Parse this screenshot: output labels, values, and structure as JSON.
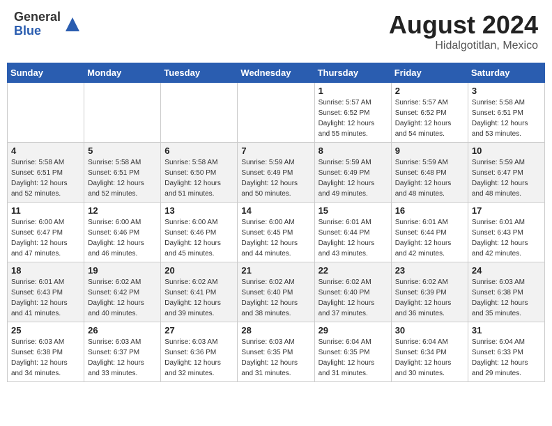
{
  "header": {
    "logo_general": "General",
    "logo_blue": "Blue",
    "title": "August 2024",
    "location": "Hidalgotitlan, Mexico"
  },
  "days_of_week": [
    "Sunday",
    "Monday",
    "Tuesday",
    "Wednesday",
    "Thursday",
    "Friday",
    "Saturday"
  ],
  "weeks": [
    {
      "row": 1,
      "days": [
        {
          "date": "",
          "info": ""
        },
        {
          "date": "",
          "info": ""
        },
        {
          "date": "",
          "info": ""
        },
        {
          "date": "",
          "info": ""
        },
        {
          "date": "1",
          "info": "Sunrise: 5:57 AM\nSunset: 6:52 PM\nDaylight: 12 hours\nand 55 minutes."
        },
        {
          "date": "2",
          "info": "Sunrise: 5:57 AM\nSunset: 6:52 PM\nDaylight: 12 hours\nand 54 minutes."
        },
        {
          "date": "3",
          "info": "Sunrise: 5:58 AM\nSunset: 6:51 PM\nDaylight: 12 hours\nand 53 minutes."
        }
      ]
    },
    {
      "row": 2,
      "days": [
        {
          "date": "4",
          "info": "Sunrise: 5:58 AM\nSunset: 6:51 PM\nDaylight: 12 hours\nand 52 minutes."
        },
        {
          "date": "5",
          "info": "Sunrise: 5:58 AM\nSunset: 6:51 PM\nDaylight: 12 hours\nand 52 minutes."
        },
        {
          "date": "6",
          "info": "Sunrise: 5:58 AM\nSunset: 6:50 PM\nDaylight: 12 hours\nand 51 minutes."
        },
        {
          "date": "7",
          "info": "Sunrise: 5:59 AM\nSunset: 6:49 PM\nDaylight: 12 hours\nand 50 minutes."
        },
        {
          "date": "8",
          "info": "Sunrise: 5:59 AM\nSunset: 6:49 PM\nDaylight: 12 hours\nand 49 minutes."
        },
        {
          "date": "9",
          "info": "Sunrise: 5:59 AM\nSunset: 6:48 PM\nDaylight: 12 hours\nand 48 minutes."
        },
        {
          "date": "10",
          "info": "Sunrise: 5:59 AM\nSunset: 6:47 PM\nDaylight: 12 hours\nand 48 minutes."
        }
      ]
    },
    {
      "row": 3,
      "days": [
        {
          "date": "11",
          "info": "Sunrise: 6:00 AM\nSunset: 6:47 PM\nDaylight: 12 hours\nand 47 minutes."
        },
        {
          "date": "12",
          "info": "Sunrise: 6:00 AM\nSunset: 6:46 PM\nDaylight: 12 hours\nand 46 minutes."
        },
        {
          "date": "13",
          "info": "Sunrise: 6:00 AM\nSunset: 6:46 PM\nDaylight: 12 hours\nand 45 minutes."
        },
        {
          "date": "14",
          "info": "Sunrise: 6:00 AM\nSunset: 6:45 PM\nDaylight: 12 hours\nand 44 minutes."
        },
        {
          "date": "15",
          "info": "Sunrise: 6:01 AM\nSunset: 6:44 PM\nDaylight: 12 hours\nand 43 minutes."
        },
        {
          "date": "16",
          "info": "Sunrise: 6:01 AM\nSunset: 6:44 PM\nDaylight: 12 hours\nand 42 minutes."
        },
        {
          "date": "17",
          "info": "Sunrise: 6:01 AM\nSunset: 6:43 PM\nDaylight: 12 hours\nand 42 minutes."
        }
      ]
    },
    {
      "row": 4,
      "days": [
        {
          "date": "18",
          "info": "Sunrise: 6:01 AM\nSunset: 6:43 PM\nDaylight: 12 hours\nand 41 minutes."
        },
        {
          "date": "19",
          "info": "Sunrise: 6:02 AM\nSunset: 6:42 PM\nDaylight: 12 hours\nand 40 minutes."
        },
        {
          "date": "20",
          "info": "Sunrise: 6:02 AM\nSunset: 6:41 PM\nDaylight: 12 hours\nand 39 minutes."
        },
        {
          "date": "21",
          "info": "Sunrise: 6:02 AM\nSunset: 6:40 PM\nDaylight: 12 hours\nand 38 minutes."
        },
        {
          "date": "22",
          "info": "Sunrise: 6:02 AM\nSunset: 6:40 PM\nDaylight: 12 hours\nand 37 minutes."
        },
        {
          "date": "23",
          "info": "Sunrise: 6:02 AM\nSunset: 6:39 PM\nDaylight: 12 hours\nand 36 minutes."
        },
        {
          "date": "24",
          "info": "Sunrise: 6:03 AM\nSunset: 6:38 PM\nDaylight: 12 hours\nand 35 minutes."
        }
      ]
    },
    {
      "row": 5,
      "days": [
        {
          "date": "25",
          "info": "Sunrise: 6:03 AM\nSunset: 6:38 PM\nDaylight: 12 hours\nand 34 minutes."
        },
        {
          "date": "26",
          "info": "Sunrise: 6:03 AM\nSunset: 6:37 PM\nDaylight: 12 hours\nand 33 minutes."
        },
        {
          "date": "27",
          "info": "Sunrise: 6:03 AM\nSunset: 6:36 PM\nDaylight: 12 hours\nand 32 minutes."
        },
        {
          "date": "28",
          "info": "Sunrise: 6:03 AM\nSunset: 6:35 PM\nDaylight: 12 hours\nand 31 minutes."
        },
        {
          "date": "29",
          "info": "Sunrise: 6:04 AM\nSunset: 6:35 PM\nDaylight: 12 hours\nand 31 minutes."
        },
        {
          "date": "30",
          "info": "Sunrise: 6:04 AM\nSunset: 6:34 PM\nDaylight: 12 hours\nand 30 minutes."
        },
        {
          "date": "31",
          "info": "Sunrise: 6:04 AM\nSunset: 6:33 PM\nDaylight: 12 hours\nand 29 minutes."
        }
      ]
    }
  ]
}
